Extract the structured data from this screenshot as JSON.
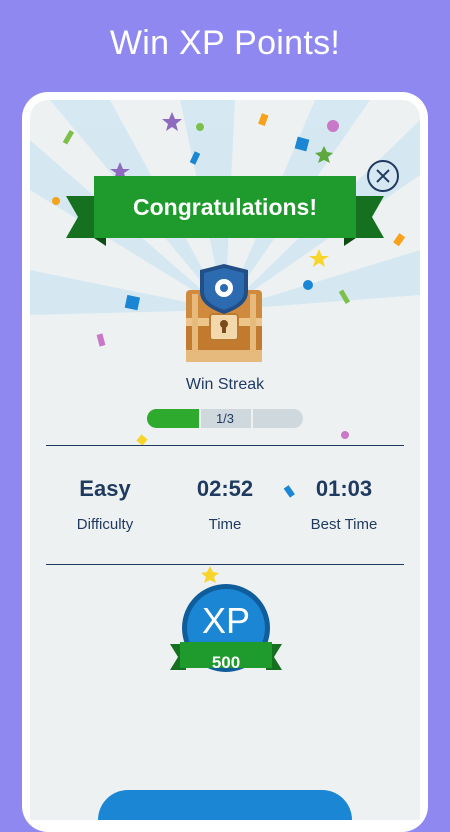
{
  "headline": "Win XP Points!",
  "dialog": {
    "banner_title": "Congratulations!",
    "reward_name": "Win Streak",
    "streak": {
      "current": 1,
      "total": 3,
      "text": "1/3"
    }
  },
  "stats": [
    {
      "value": "Easy",
      "label": "Difficulty"
    },
    {
      "value": "02:52",
      "label": "Time"
    },
    {
      "value": "01:03",
      "label": "Best Time"
    }
  ],
  "xp": {
    "title": "XP",
    "amount": "500"
  },
  "colors": {
    "background": "#8f88f0",
    "banner_green": "#1f9a2c",
    "progress_green": "#2eaa2e",
    "xp_blue": "#1b86d4",
    "navy_text": "#1f3a5f"
  },
  "icons": {
    "close": "close-icon",
    "chest": "treasure-chest-icon",
    "xp": "xp-badge-icon"
  }
}
